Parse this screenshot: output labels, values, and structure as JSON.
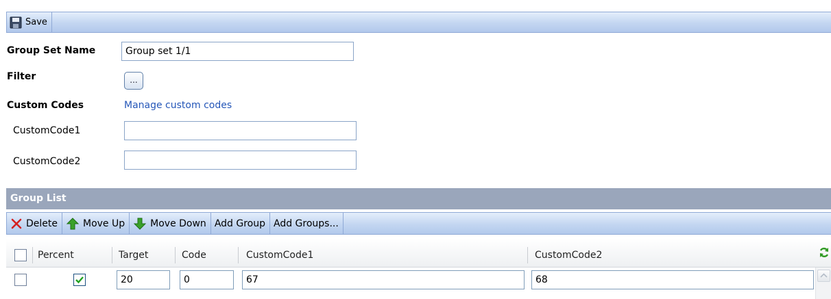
{
  "toolbar": {
    "save_label": "Save"
  },
  "form": {
    "group_set_name_label": "Group Set Name",
    "group_set_name_value": "Group set 1/1",
    "filter_label": "Filter",
    "filter_button_label": "...",
    "custom_codes_label": "Custom Codes",
    "manage_link": "Manage custom codes",
    "custom_code1_label": "CustomCode1",
    "custom_code1_value": "",
    "custom_code2_label": "CustomCode2",
    "custom_code2_value": ""
  },
  "group_list": {
    "title": "Group List",
    "toolbar": {
      "delete": "Delete",
      "move_up": "Move Up",
      "move_down": "Move Down",
      "add_group": "Add Group",
      "add_groups": "Add Groups..."
    },
    "columns": [
      "Percent",
      "Target",
      "Code",
      "CustomCode1",
      "CustomCode2"
    ],
    "rows": [
      {
        "selected": false,
        "percent": true,
        "target": "20",
        "code": "0",
        "custom_code1": "67",
        "custom_code2": "68"
      }
    ]
  },
  "colors": {
    "toolbar_border": "#8fa9d6",
    "header_bar": "#9aa6bb",
    "link": "#2456b8",
    "delete_icon": "#d42020",
    "arrow_icon": "#3aa12a"
  },
  "icons": [
    "save-icon",
    "delete-icon",
    "move-up-icon",
    "move-down-icon",
    "refresh-icon"
  ]
}
